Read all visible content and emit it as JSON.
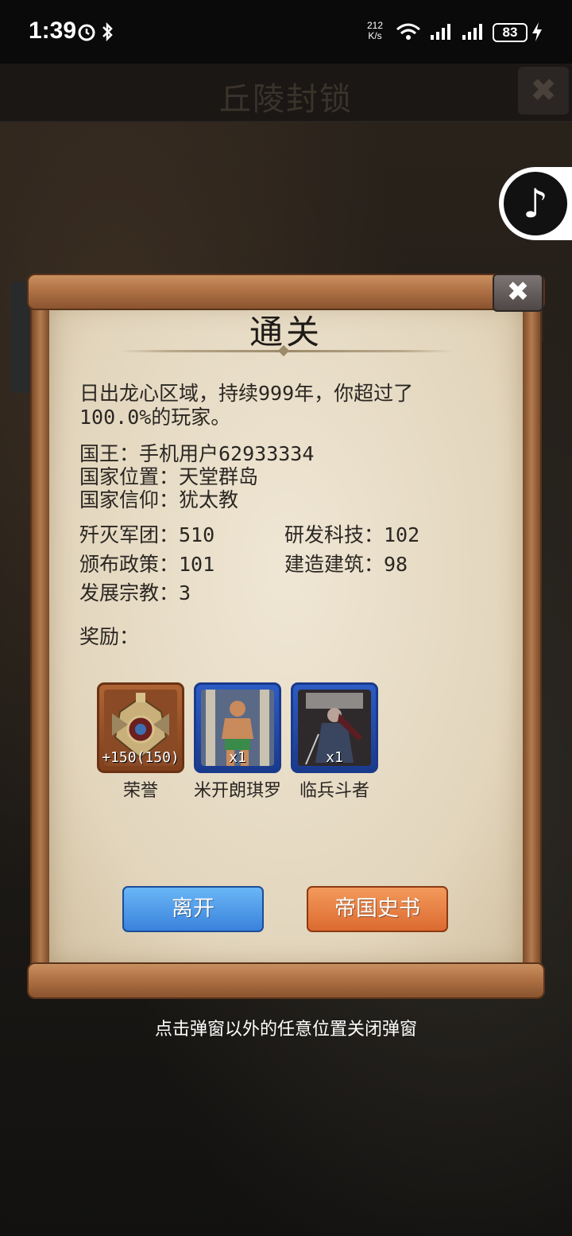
{
  "status_bar": {
    "time": "1:39",
    "speed_value": "212",
    "speed_unit": "K/s",
    "battery": "83"
  },
  "game": {
    "title": "丘陵封锁",
    "close_glyph": "✖"
  },
  "dialog": {
    "title": "通关",
    "close_glyph": "✖",
    "summary_line1": "日出龙心区域，持续999年，你超过了",
    "summary_line2": "100.0%的玩家。",
    "king": "国王：手机用户62933334",
    "location": "国家位置：天堂群岛",
    "faith": "国家信仰：犹太教",
    "stats": {
      "armies_destroyed": "歼灭军团：510",
      "tech_researched": "研发科技：102",
      "policies": "颁布政策：101",
      "buildings": "建造建筑：98",
      "religions": "发展宗教：3"
    },
    "rewards_label": "奖励：",
    "rewards": [
      {
        "name": "荣誉",
        "count": "+150(150)"
      },
      {
        "name": "米开朗琪罗",
        "count": "x1"
      },
      {
        "name": "临兵斗者",
        "count": "x1"
      }
    ],
    "leave_button": "离开",
    "history_button": "帝国史书"
  },
  "hint": "点击弹窗以外的任意位置关闭弹窗",
  "colors": {
    "paper": "#e9dfcb",
    "scroll_wood": "#b07245",
    "leave_blue": "#3a82dc",
    "history_orange": "#dc6a30"
  }
}
